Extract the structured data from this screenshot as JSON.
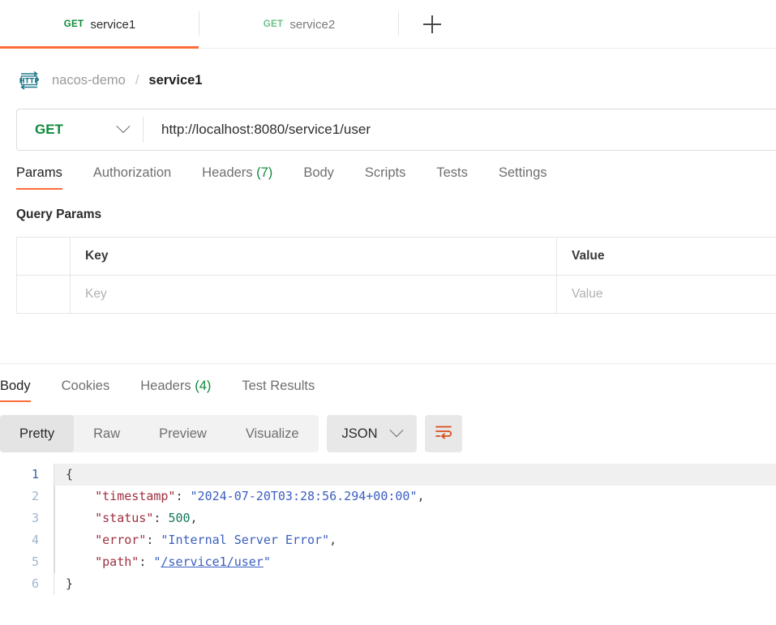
{
  "tabs": {
    "items": [
      {
        "method": "GET",
        "name": "service1",
        "active": true
      },
      {
        "method": "GET",
        "name": "service2",
        "active": false
      }
    ],
    "new_tab_icon": "plus-icon"
  },
  "breadcrumb": {
    "protocol_icon": "http-icon",
    "protocol_label": "HTTP",
    "collection": "nacos-demo",
    "separator": "/",
    "request": "service1"
  },
  "url_bar": {
    "method": "GET",
    "method_chevron_icon": "chevron-down-icon",
    "url": "http://localhost:8080/service1/user"
  },
  "request_tabs": {
    "items": [
      {
        "label": "Params",
        "count": "",
        "active": true
      },
      {
        "label": "Authorization",
        "count": "",
        "active": false
      },
      {
        "label": "Headers",
        "count": "(7)",
        "active": false
      },
      {
        "label": "Body",
        "count": "",
        "active": false
      },
      {
        "label": "Scripts",
        "count": "",
        "active": false
      },
      {
        "label": "Tests",
        "count": "",
        "active": false
      },
      {
        "label": "Settings",
        "count": "",
        "active": false
      }
    ]
  },
  "query_params": {
    "section_title": "Query Params",
    "headers": {
      "key": "Key",
      "value": "Value"
    },
    "rows": [
      {
        "key_placeholder": "Key",
        "value_placeholder": "Value"
      }
    ]
  },
  "response_tabs": {
    "items": [
      {
        "label": "Body",
        "count": "",
        "active": true
      },
      {
        "label": "Cookies",
        "count": "",
        "active": false
      },
      {
        "label": "Headers",
        "count": "(4)",
        "active": false
      },
      {
        "label": "Test Results",
        "count": "",
        "active": false
      }
    ]
  },
  "format_bar": {
    "views": [
      {
        "label": "Pretty",
        "active": true
      },
      {
        "label": "Raw",
        "active": false
      },
      {
        "label": "Preview",
        "active": false
      },
      {
        "label": "Visualize",
        "active": false
      }
    ],
    "language": "JSON",
    "language_chevron_icon": "chevron-down-icon",
    "wrap_button_icon": "word-wrap-icon"
  },
  "response_body": {
    "line_numbers": [
      "1",
      "2",
      "3",
      "4",
      "5",
      "6"
    ],
    "lines": [
      {
        "n": "1",
        "open_brace": "{"
      },
      {
        "n": "2",
        "key": "\"timestamp\"",
        "colon": ": ",
        "value": "\"2024-07-20T03:28:56.294+00:00\"",
        "comma": ","
      },
      {
        "n": "3",
        "key": "\"status\"",
        "colon": ": ",
        "value": "500",
        "comma": ","
      },
      {
        "n": "4",
        "key": "\"error\"",
        "colon": ": ",
        "value": "\"Internal Server Error\"",
        "comma": ","
      },
      {
        "n": "5",
        "key": "\"path\"",
        "colon": ": ",
        "quote_open": "\"",
        "link": "/service1/user",
        "quote_close": "\""
      },
      {
        "n": "6",
        "close_brace": "}"
      }
    ]
  },
  "colors": {
    "accent_orange": "#ff6c37",
    "method_green": "#0f8a3c",
    "method_green_muted": "#6dc088",
    "json_key": "#a03040",
    "json_string": "#3b5fc0",
    "json_number": "#12795a",
    "http_icon_teal": "#1f7a8c"
  }
}
